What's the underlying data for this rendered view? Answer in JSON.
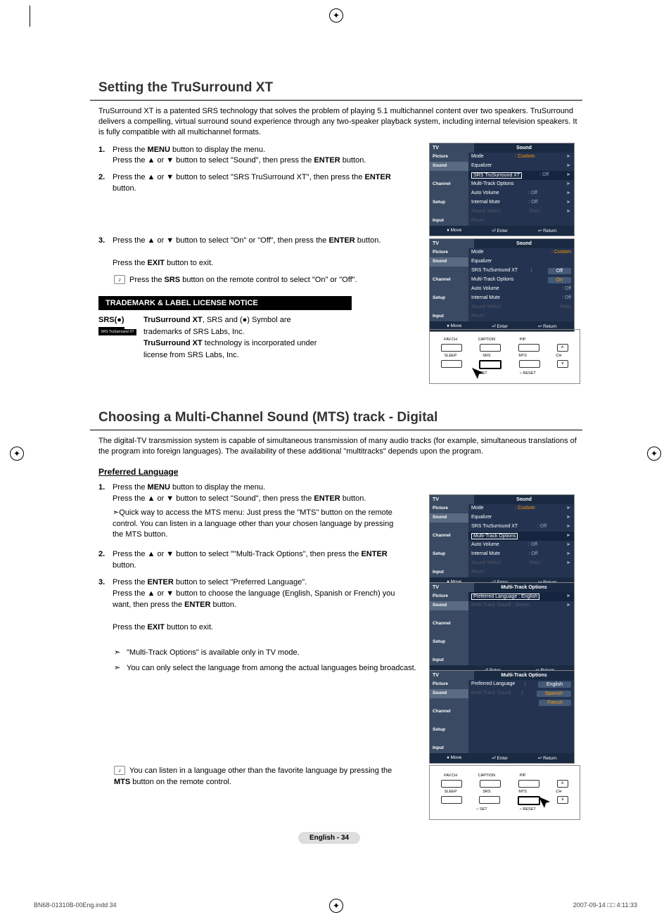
{
  "section1": {
    "title": "Setting the TruSurround XT",
    "intro": "TruSurround XT is a patented SRS technology that solves the problem of playing 5.1 multichannel content over two speakers. TruSurround delivers a compelling, virtual surround sound experience through any two-speaker playback system, including internal television speakers. It is fully compatible with all multichannel formats.",
    "step1a": "Press the ",
    "step1b": "MENU",
    "step1c": " button to display the menu.",
    "step1d": "Press the ▲ or ▼ button to select \"Sound\", then press the ",
    "step1e": "ENTER",
    "step1f": " button.",
    "step2a": "Press the ▲ or ▼ button to select \"SRS TruSurround XT\", then press the ",
    "step2b": "ENTER",
    "step2c": " button.",
    "step3a": "Press the ▲ or ▼ button to select \"On\" or \"Off\", then press the ",
    "step3b": "ENTER",
    "step3c": " button.",
    "step3d": "Press the ",
    "step3e": "EXIT",
    "step3f": " button to exit.",
    "noteM1a": "Press the ",
    "noteM1b": "SRS",
    "noteM1c": " button on the remote control to select \"On\" or \"Off\".",
    "tmHeader": "TRADEMARK & LABEL LICENSE NOTICE",
    "tm1a": "TruSurround XT",
    "tm1b": ", SRS and ",
    "tm1c": " Symbol are trademarks of SRS Labs, Inc.",
    "tm2a": "TruSurround XT",
    "tm2b": " technology is incorporated under license from SRS Labs, Inc.",
    "srsLogo": "SRS(●)",
    "srsLogoSub": "SRS TruSurround XT"
  },
  "section2": {
    "title": "Choosing a Multi-Channel Sound (MTS) track - Digital",
    "intro": "The digital-TV transmission system is capable of simultaneous transmission of many audio tracks (for example, simultaneous translations of the program into foreign languages). The availability of these additional \"multitracks\" depends upon the program.",
    "sub": "Preferred Language",
    "step1a": "Press the ",
    "step1b": "MENU",
    "step1c": " button to display the menu.",
    "step1d": "Press the ▲ or ▼ button to select \"Sound\", then press the ",
    "step1e": "ENTER",
    "step1f": " button.",
    "quick": "Quick way to access the MTS menu: Just press the \"MTS\" button on the remote control. You can listen in a language other than your chosen language by pressing the MTS button.",
    "step2a": "Press the ▲ or ▼ button to select \"\"Multi-Track Options\", then press the ",
    "step2b": "ENTER",
    "step2c": " button.",
    "step3a": "Press the ",
    "step3b": "ENTER",
    "step3c": " button to select \"Preferred Language\".",
    "step3d": "Press the ▲ or ▼ button to choose the language (English, Spanish or French) you want, then press the ",
    "step3e": "ENTER",
    "step3f": " button.",
    "step3g": "Press the ",
    "step3h": "EXIT",
    "step3i": " button to exit.",
    "noteA1": "\"Multi-Track Options\" is available only in TV mode.",
    "noteA2": "You can only select the language from among the actual languages being broadcast.",
    "noteM2a": "You can listen in a language other than the favorite language by pressing the ",
    "noteM2b": "MTS",
    "noteM2c": " button on the remote control."
  },
  "osd": {
    "tv": "TV",
    "sound": "Sound",
    "side": {
      "picture": "Picture",
      "sound": "Sound",
      "channel": "Channel",
      "setup": "Setup",
      "input": "Input"
    },
    "items": {
      "mode": "Mode",
      "modeVal": ": Custom",
      "eq": "Equalizer",
      "srs": "SRS TruSurround XT",
      "srsVal": ": Off",
      "mto": "Multi-Track Options",
      "av": "Auto Volume",
      "avVal": ": Off",
      "im": "Internal Mute",
      "imVal": ": Off",
      "ss": "Sound Select",
      "ssVal": ": Main",
      "reset": "Reset"
    },
    "off": "Off",
    "on": "On",
    "foot": {
      "move": "♦ Move",
      "enter": "⏎ Enter",
      "return": "↩ Return"
    },
    "mtoTitle": "Multi-Track Options",
    "pl": "Preferred Language",
    "plVal": ": English",
    "mts": "Multi-Track Sound",
    "mtsVal": ": Stereo",
    "lang": {
      "en": "English",
      "es": "Spanish",
      "fr": "French"
    }
  },
  "remote": {
    "favch": "FAV.CH",
    "caption": "CAPTION",
    "pip": "PIP",
    "sleep": "SLEEP",
    "srs": "SRS",
    "mts": "MTS",
    "ch": "CH",
    "set": "○ SET",
    "reset": "○ RESET"
  },
  "pageNum": "English - 34",
  "footerLeft": "BN68-01310B-00Eng.indd   34",
  "footerRight": "2007-09-14   □□ 4:11:33"
}
